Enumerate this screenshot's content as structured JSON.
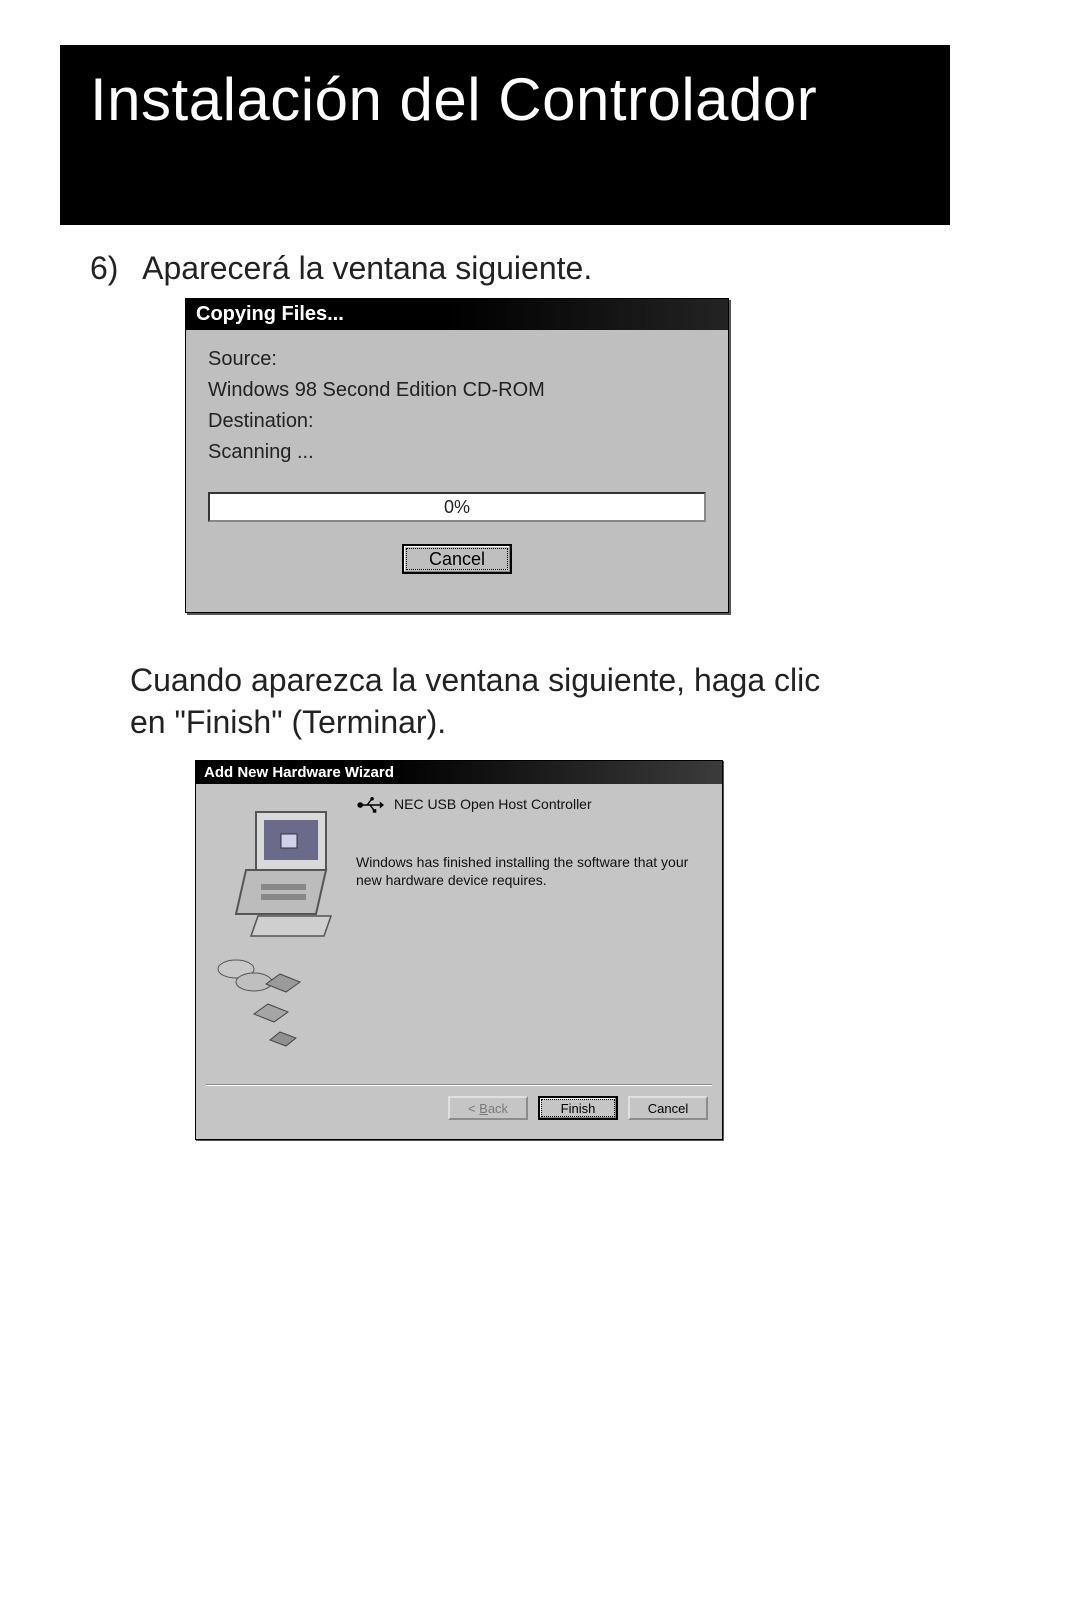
{
  "header": {
    "title": "Instalación del Controlador"
  },
  "step": {
    "number": "6)",
    "text": "Aparecerá la ventana siguiente."
  },
  "dialog_copy": {
    "title": "Copying Files...",
    "source_label": "Source:",
    "source_value": "Windows 98 Second Edition CD-ROM",
    "dest_label": "Destination:",
    "dest_value": "Scanning ...",
    "progress_text": "0%",
    "cancel_label": "Cancel"
  },
  "paragraph2": "Cuando aparezca la ventana siguiente, haga clic en \"Finish\" (Terminar).",
  "dialog_wizard": {
    "title": "Add New Hardware Wizard",
    "device_name": "NEC USB Open Host Controller",
    "message": "Windows has finished installing the software that your new hardware device requires.",
    "back_label": "< Back",
    "finish_label": "Finish",
    "cancel_label": "Cancel"
  }
}
